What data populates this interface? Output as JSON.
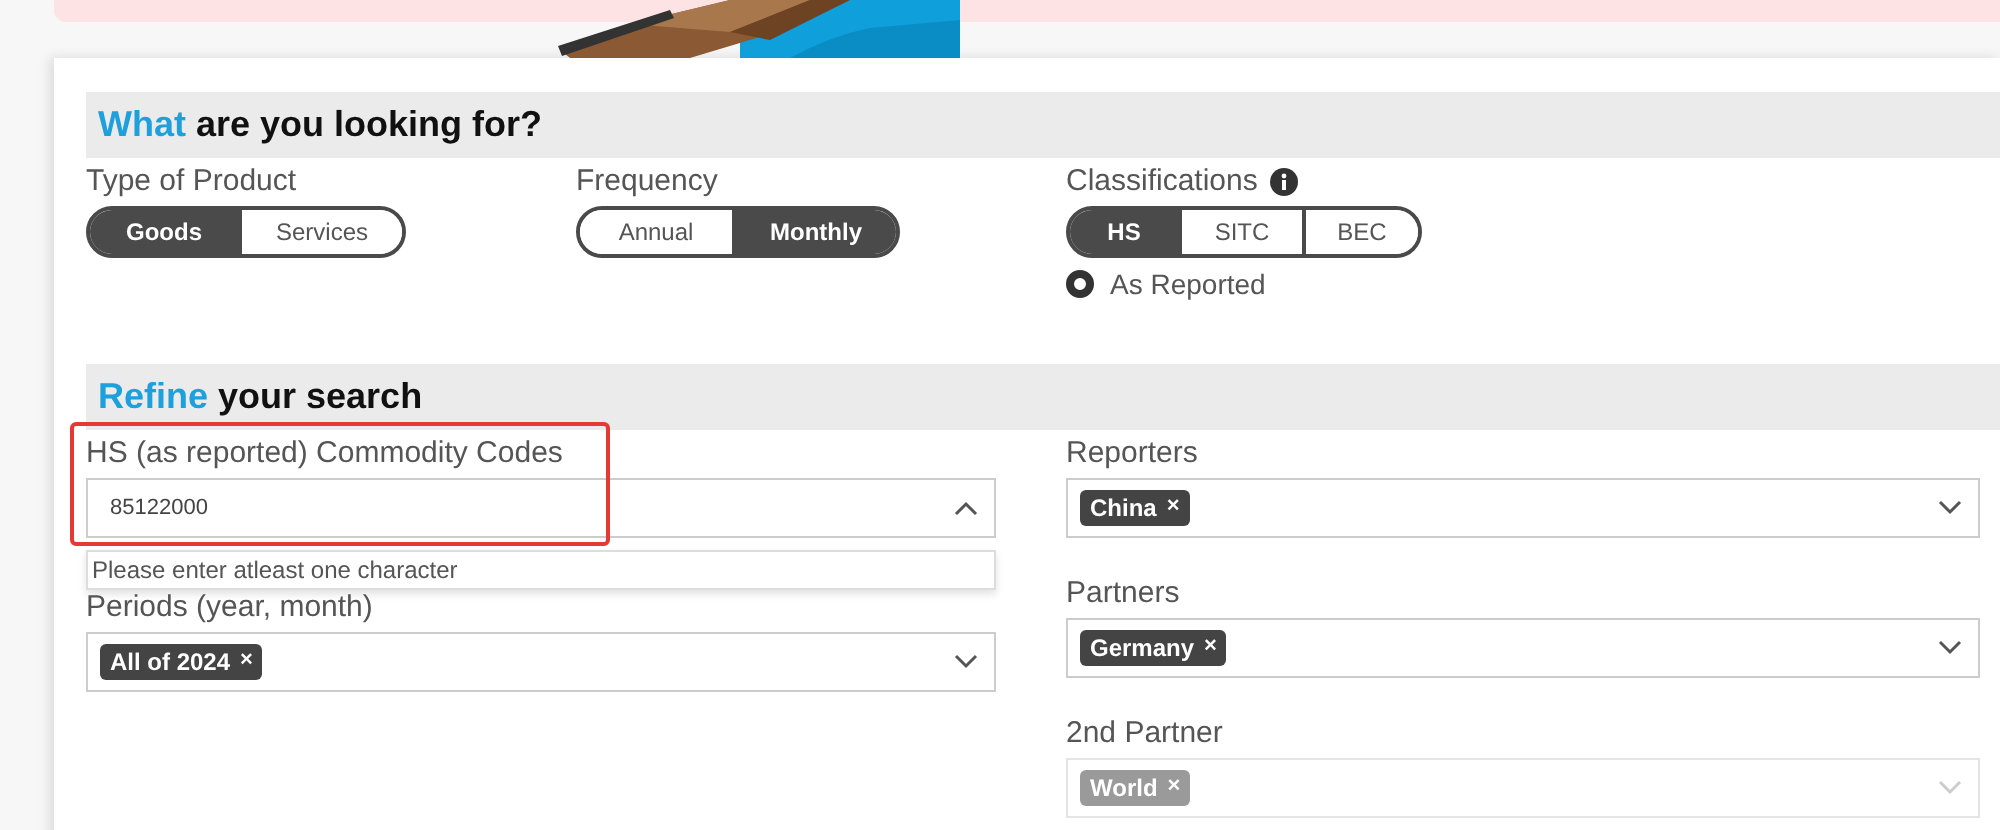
{
  "what_section": {
    "title_highlight": "What",
    "title_rest": "are you looking for?",
    "type_of_product": {
      "label": "Type of Product",
      "options": [
        {
          "label": "Goods",
          "selected": true
        },
        {
          "label": "Services",
          "selected": false
        }
      ]
    },
    "frequency": {
      "label": "Frequency",
      "options": [
        {
          "label": "Annual",
          "selected": false
        },
        {
          "label": "Monthly",
          "selected": true
        }
      ]
    },
    "classifications": {
      "label": "Classifications",
      "options": [
        {
          "label": "HS",
          "selected": true
        },
        {
          "label": "SITC",
          "selected": false
        },
        {
          "label": "BEC",
          "selected": false
        }
      ],
      "radio": {
        "label": "As Reported",
        "selected": true
      }
    }
  },
  "refine_section": {
    "title_highlight": "Refine",
    "title_rest": "your search",
    "commodity_codes": {
      "label": "HS (as reported) Commodity Codes",
      "value": "85122000",
      "expanded": true,
      "highlighted": true,
      "hint": "Please enter atleast one character"
    },
    "periods": {
      "label": "Periods (year, month)",
      "disabled": false,
      "tags": [
        {
          "label": "All of 2024",
          "remove": "×"
        }
      ]
    },
    "reporters": {
      "label": "Reporters",
      "disabled": false,
      "tags": [
        {
          "label": "China",
          "remove": "×"
        }
      ]
    },
    "partners": {
      "label": "Partners",
      "disabled": false,
      "tags": [
        {
          "label": "Germany",
          "remove": "×"
        }
      ]
    },
    "second_partner": {
      "label": "2nd Partner",
      "disabled": true,
      "tags": [
        {
          "label": "World",
          "remove": "×"
        }
      ]
    }
  }
}
